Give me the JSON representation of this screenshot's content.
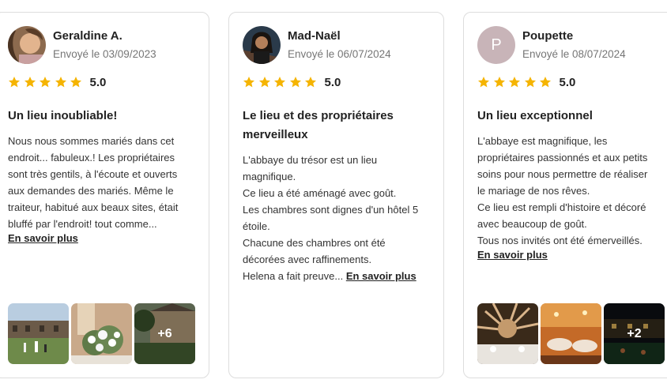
{
  "colors": {
    "star": "#f5b400",
    "text": "#222222",
    "muted": "#767676",
    "border": "#dddddd",
    "avatar_initial_bg": "#c8b4b8"
  },
  "reviews": [
    {
      "name": "Geraldine A.",
      "date": "Envoyé le 03/09/2023",
      "rating": 5,
      "score": "5.0",
      "title": "Un lieu inoubliable!",
      "body_lines": [
        "Nous nous sommes mariés dans cet",
        "endroit... fabuleux.! Les propriétaires",
        "sont très gentils, à l'écoute et ouverts",
        "aux demandes des mariés. Même le",
        "traiteur, habitué aux beaux sites, était",
        "bluffé par l'endroit! tout comme..."
      ],
      "more_label": "En savoir plus",
      "photo_more": "+6"
    },
    {
      "name": "Mad-Naël",
      "date": "Envoyé le 06/07/2024",
      "rating": 5,
      "score": "5.0",
      "title_lines": [
        "Le lieu et des propriétaires",
        "merveilleux"
      ],
      "body_lines": [
        "L'abbaye du trésor est un lieu",
        "magnifique.",
        "Ce lieu a été aménagé avec goût.",
        "Les chambres sont dignes d'un hôtel 5",
        "étoile.",
        "Chacune des chambres ont été",
        "décorées avec raffinements."
      ],
      "last_line": "Helena a fait preuve...",
      "more_label": "En savoir plus"
    },
    {
      "name": "Poupette",
      "initial": "P",
      "date": "Envoyé le 08/07/2024",
      "rating": 5,
      "score": "5.0",
      "title": "Un lieu exceptionnel",
      "body_lines": [
        "L'abbaye est magnifique, les",
        "propriétaires passionnés et aux petits",
        "soins pour nous permettre de réaliser",
        "le mariage de nos rêves.",
        "Ce lieu est rempli d'histoire et décoré",
        "avec beaucoup de goût.",
        "Tous nos invités ont été émerveillés."
      ],
      "more_label": "En savoir plus",
      "photo_more": "+2"
    }
  ]
}
